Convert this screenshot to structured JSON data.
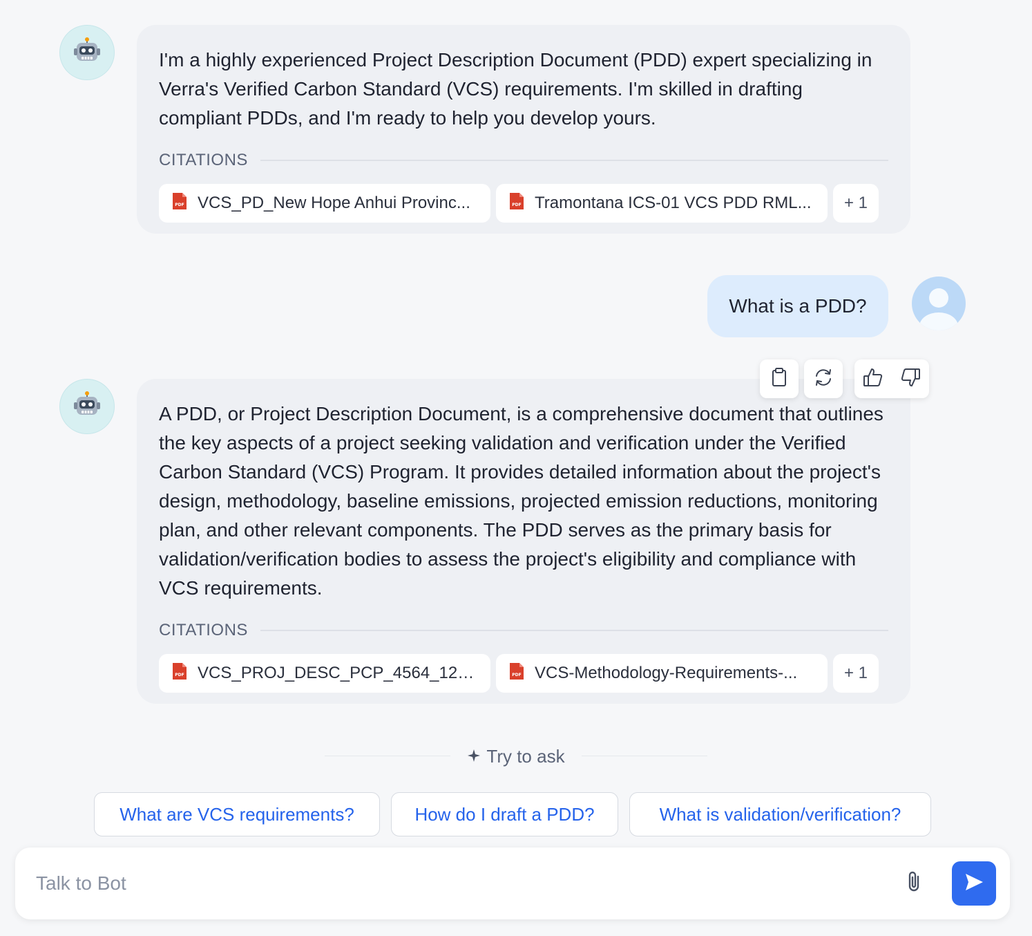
{
  "messages": [
    {
      "role": "bot",
      "avatar_icon": "robot-icon",
      "text": "I'm a highly experienced Project Description Document (PDD) expert specializing in Verra's Verified Carbon Standard (VCS) requirements. I'm skilled in drafting compliant PDDs, and I'm ready to help you develop yours.",
      "citations_label": "CITATIONS",
      "citations": [
        {
          "icon": "pdf-icon",
          "name": "VCS_PD_New Hope Anhui Provinc..."
        },
        {
          "icon": "pdf-icon",
          "name": "Tramontana ICS-01 VCS PDD RML..."
        }
      ],
      "more_label": "+ 1"
    },
    {
      "role": "user",
      "avatar_icon": "user-avatar-icon",
      "text": "What is a PDD?"
    },
    {
      "role": "bot",
      "avatar_icon": "robot-icon",
      "text": "A PDD, or Project Description Document, is a comprehensive document that outlines the key aspects of a project seeking validation and verification under the Verified Carbon Standard (VCS) Program. It provides detailed information about the project's design, methodology, baseline emissions, projected emission reductions, monitoring plan, and other relevant components. The PDD serves as the primary basis for validation/verification bodies to assess the project's eligibility and compliance with VCS requirements.",
      "citations_label": "CITATIONS",
      "citations": [
        {
          "icon": "pdf-icon",
          "name": "VCS_PROJ_DESC_PCP_4564_12S..."
        },
        {
          "icon": "pdf-icon",
          "name": "VCS-Methodology-Requirements-..."
        }
      ],
      "more_label": "+ 1",
      "actions": [
        "copy-icon",
        "regenerate-icon",
        "thumbs-up-icon",
        "thumbs-down-icon"
      ]
    }
  ],
  "try_ask": {
    "icon": "sparkle-icon",
    "label": "Try to ask",
    "suggestions": [
      "What are VCS requirements?",
      "How do I draft a PDD?",
      "What is validation/verification?"
    ]
  },
  "composer": {
    "placeholder": "Talk to Bot",
    "value": "",
    "attach_icon": "paperclip-icon",
    "send_icon": "send-icon"
  },
  "colors": {
    "background": "#f6f7f9",
    "bot_bubble": "#eef0f4",
    "user_bubble": "#ddecfd",
    "accent": "#2f6bef",
    "link": "#2563eb",
    "pdf": "#d9402b"
  }
}
